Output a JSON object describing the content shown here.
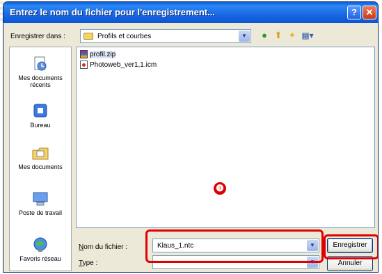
{
  "dialog": {
    "title": "Entrez le nom du fichier pour l'enregistrement...",
    "help_label": "?",
    "close_label": "✕"
  },
  "toolbar": {
    "save_in_label": "Enregistrer dans :",
    "current_folder": "Profils et courbes",
    "back_icon": "back-icon",
    "up_icon": "up-folder-icon",
    "new_folder_icon": "new-folder-icon",
    "views_icon": "views-menu-icon"
  },
  "places": [
    {
      "label": "Mes documents récents",
      "icon": "recent-documents-icon"
    },
    {
      "label": "Bureau",
      "icon": "desktop-icon"
    },
    {
      "label": "Mes documents",
      "icon": "my-documents-icon"
    },
    {
      "label": "Poste de travail",
      "icon": "my-computer-icon"
    },
    {
      "label": "Favoris réseau",
      "icon": "network-places-icon"
    }
  ],
  "files": [
    {
      "name": "profil.zip",
      "icon": "zip-icon",
      "selected": true
    },
    {
      "name": "Photoweb_ver1,1.icm",
      "icon": "icm-file-icon",
      "selected": false
    }
  ],
  "annotation": {
    "badge": "❹",
    "highlight_color": "#e00000"
  },
  "form": {
    "filename_label": "Nom du fichier :",
    "filename_value": "Klaus_1.ntc",
    "type_label": "Type :",
    "type_value": "",
    "save_button": "Enregistrer",
    "cancel_button": "Annuler"
  },
  "colors": {
    "title_bar": "#1c6ae6",
    "dialog_bg": "#ece9d8",
    "annotation_red": "#e00000"
  }
}
